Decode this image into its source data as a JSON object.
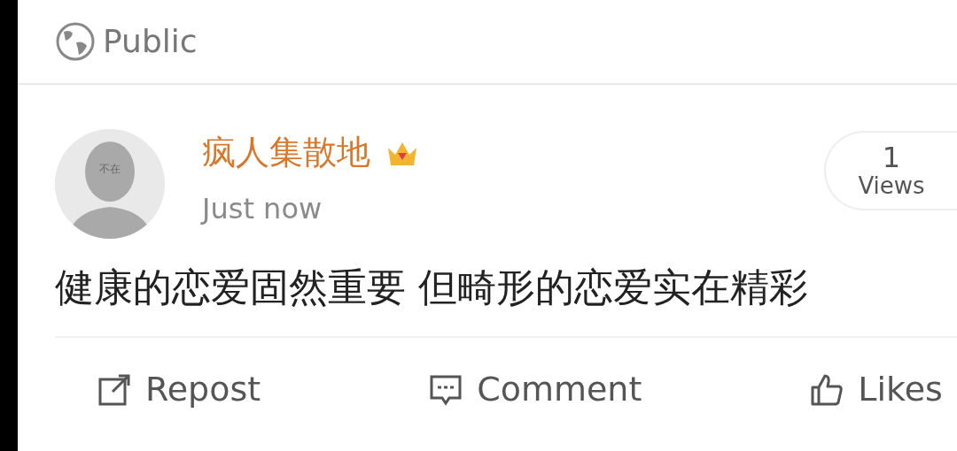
{
  "visibility": {
    "label": "Public"
  },
  "post": {
    "author": "疯人集散地",
    "avatar_label": "不在",
    "time": "Just now",
    "views": {
      "count": "1",
      "label": "Views"
    },
    "text": "健康的恋爱固然重要 但畸形的恋爱实在精彩"
  },
  "actions": [
    {
      "kind": "repost",
      "label": "Repost"
    },
    {
      "kind": "comment",
      "label": "Comment"
    },
    {
      "kind": "like",
      "label": "Likes"
    }
  ]
}
